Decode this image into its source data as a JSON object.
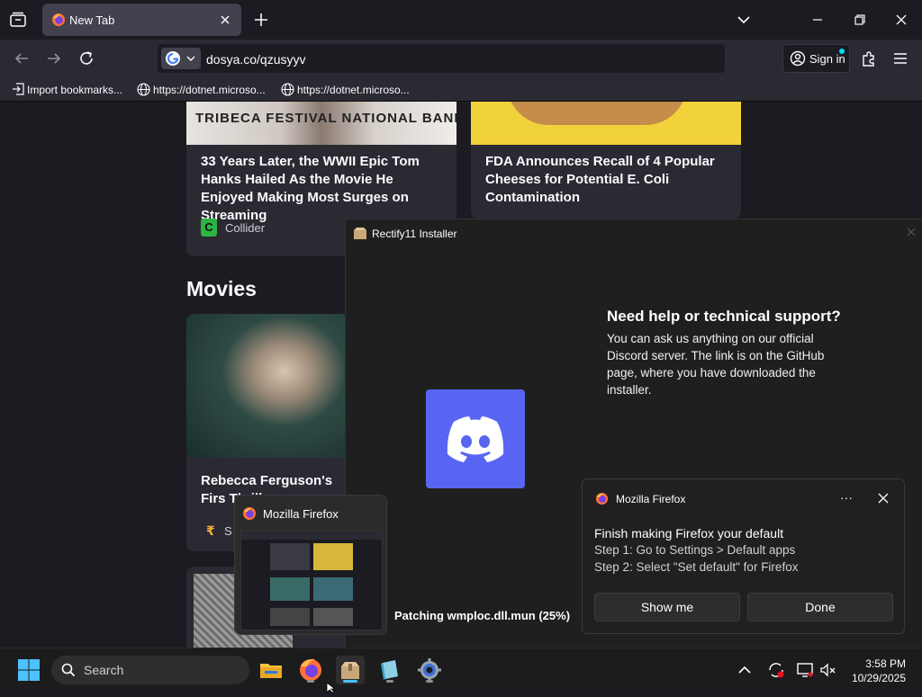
{
  "browser": {
    "tab_title": "New Tab",
    "url": "dosya.co/qzusyyv",
    "signin_label": "Sign in",
    "bookmarks": [
      "Import bookmarks...",
      "https://dotnet.microso...",
      "https://dotnet.microso..."
    ]
  },
  "feed": {
    "cards": [
      {
        "headline": "33 Years Later, the WWII Epic Tom Hanks Hailed As the Movie He Enjoyed Making Most Surges on Streaming",
        "source": "Collider",
        "image_text": "TRIBECA FESTIVAL  NATIONAL BANK"
      },
      {
        "headline": "FDA Announces Recall of 4 Popular Cheeses for Potential E. Coli Contamination"
      }
    ],
    "section_title": "Movies",
    "movie_card": {
      "headline": "Rebecca Ferguson's Firs Thrille",
      "source_initial": "S"
    }
  },
  "installer": {
    "title": "Rectify11 Installer",
    "help_heading": "Need help or technical support?",
    "help_body": "You can ask us anything on our official Discord server. The link is on the GitHub page, where you have downloaded the installer.",
    "status": "Patching wmploc.dll.mun (25%)"
  },
  "notification": {
    "app": "Mozilla Firefox",
    "title": "Finish making Firefox your default",
    "step1": "Step 1: Go to Settings > Default apps",
    "step2": "Step 2: Select \"Set default\" for Firefox",
    "primary_btn": "Show me",
    "secondary_btn": "Done",
    "more": "···"
  },
  "preview": {
    "title": "Mozilla Firefox"
  },
  "taskbar": {
    "search_label": "Search",
    "time": "3:58 PM",
    "date": "10/29/2025"
  },
  "colors": {
    "accent": "#4cc2ff",
    "discord": "#5865f2",
    "firefox": "#ff7139"
  }
}
